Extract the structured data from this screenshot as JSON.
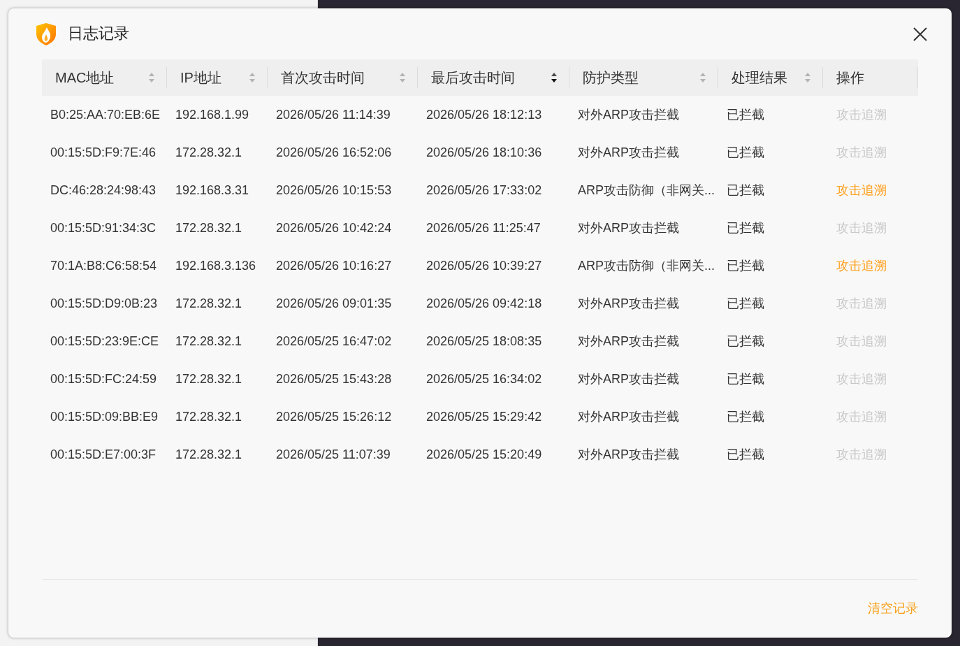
{
  "dialog": {
    "title": "日志记录"
  },
  "table": {
    "columns": [
      {
        "label": "MAC地址",
        "sortable": true,
        "sorted": false
      },
      {
        "label": "IP地址",
        "sortable": true,
        "sorted": false
      },
      {
        "label": "首次攻击时间",
        "sortable": true,
        "sorted": false
      },
      {
        "label": "最后攻击时间",
        "sortable": true,
        "sorted": true
      },
      {
        "label": "防护类型",
        "sortable": true,
        "sorted": false
      },
      {
        "label": "处理结果",
        "sortable": true,
        "sorted": false
      },
      {
        "label": "操作",
        "sortable": false
      }
    ],
    "rows": [
      {
        "mac": "B0:25:AA:70:EB:6E",
        "ip": "192.168.1.99",
        "first_attack": "2026/05/26 11:14:39",
        "last_attack": "2026/05/26 18:12:13",
        "protection_type": "对外ARP攻击拦截",
        "result": "已拦截",
        "action": {
          "label": "攻击追溯",
          "disabled": true
        }
      },
      {
        "mac": "00:15:5D:F9:7E:46",
        "ip": "172.28.32.1",
        "first_attack": "2026/05/26 16:52:06",
        "last_attack": "2026/05/26 18:10:36",
        "protection_type": "对外ARP攻击拦截",
        "result": "已拦截",
        "action": {
          "label": "攻击追溯",
          "disabled": true
        }
      },
      {
        "mac": "DC:46:28:24:98:43",
        "ip": "192.168.3.31",
        "first_attack": "2026/05/26 10:15:53",
        "last_attack": "2026/05/26 17:33:02",
        "protection_type": "ARP攻击防御（非网关...",
        "result": "已拦截",
        "action": {
          "label": "攻击追溯",
          "disabled": false
        }
      },
      {
        "mac": "00:15:5D:91:34:3C",
        "ip": "172.28.32.1",
        "first_attack": "2026/05/26 10:42:24",
        "last_attack": "2026/05/26 11:25:47",
        "protection_type": "对外ARP攻击拦截",
        "result": "已拦截",
        "action": {
          "label": "攻击追溯",
          "disabled": true
        }
      },
      {
        "mac": "70:1A:B8:C6:58:54",
        "ip": "192.168.3.136",
        "first_attack": "2026/05/26 10:16:27",
        "last_attack": "2026/05/26 10:39:27",
        "protection_type": "ARP攻击防御（非网关...",
        "result": "已拦截",
        "action": {
          "label": "攻击追溯",
          "disabled": false
        }
      },
      {
        "mac": "00:15:5D:D9:0B:23",
        "ip": "172.28.32.1",
        "first_attack": "2026/05/26 09:01:35",
        "last_attack": "2026/05/26 09:42:18",
        "protection_type": "对外ARP攻击拦截",
        "result": "已拦截",
        "action": {
          "label": "攻击追溯",
          "disabled": true
        }
      },
      {
        "mac": "00:15:5D:23:9E:CE",
        "ip": "172.28.32.1",
        "first_attack": "2026/05/25 16:47:02",
        "last_attack": "2026/05/25 18:08:35",
        "protection_type": "对外ARP攻击拦截",
        "result": "已拦截",
        "action": {
          "label": "攻击追溯",
          "disabled": true
        }
      },
      {
        "mac": "00:15:5D:FC:24:59",
        "ip": "172.28.32.1",
        "first_attack": "2026/05/25 15:43:28",
        "last_attack": "2026/05/25 16:34:02",
        "protection_type": "对外ARP攻击拦截",
        "result": "已拦截",
        "action": {
          "label": "攻击追溯",
          "disabled": true
        }
      },
      {
        "mac": "00:15:5D:09:BB:E9",
        "ip": "172.28.32.1",
        "first_attack": "2026/05/25 15:26:12",
        "last_attack": "2026/05/25 15:29:42",
        "protection_type": "对外ARP攻击拦截",
        "result": "已拦截",
        "action": {
          "label": "攻击追溯",
          "disabled": true
        }
      },
      {
        "mac": "00:15:5D:E7:00:3F",
        "ip": "172.28.32.1",
        "first_attack": "2026/05/25 11:07:39",
        "last_attack": "2026/05/25 15:20:49",
        "protection_type": "对外ARP攻击拦截",
        "result": "已拦截",
        "action": {
          "label": "攻击追溯",
          "disabled": true
        }
      }
    ]
  },
  "footer": {
    "clear_button": "清空记录"
  }
}
